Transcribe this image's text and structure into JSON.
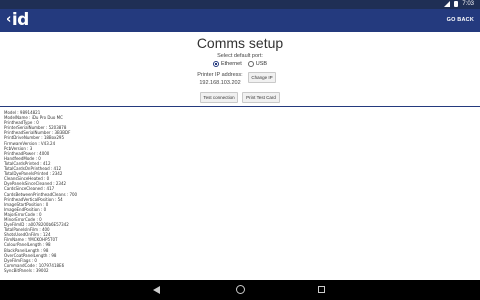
{
  "status_bar": {
    "time": "7:03"
  },
  "app_bar": {
    "logo": "id",
    "go_back": "GO BACK"
  },
  "header": {
    "title": "Comms setup",
    "subtitle": "Select default port:",
    "radio_ethernet": "Ethernet",
    "radio_usb": "USB",
    "ip_label": "Printer IP address:",
    "ip_value": "192.168.103.202",
    "change_ip": "Change IP",
    "test_connection": "Test connection",
    "print_test_card": "Print Test Card"
  },
  "printer_info": [
    "Model : 98914821",
    "ModelName : iDu Pro Duo MC",
    "PrintheadType : 0",
    "PrinterSerialNumber : 5203878",
    "PrintheadSerialNumber : 3B3BDF",
    "PrintDriveNumber : 18Box295",
    "FirmwareVersion : V43.24",
    "PcbVersion : 3",
    "PrintheadPower : 4000",
    "HandfeedMode : 0",
    "TotalCardsPrinted : 412",
    "TotalCardsOnPrinthead : 412",
    "TotalDyePanelsPrinted : 2342",
    "CleansSinceHeated : 0",
    "DyePanelsSinceCleaned : 2342",
    "CardsSinceCleaned : 417",
    "CardsBetweenPrintheadCleans : 700",
    "PrintheadVerticalPosition : 54",
    "ImageStartPosition : 0",
    "ImageEndPosition : 0",
    "MajorErrorCode : 0",
    "MinorErrorCode : 0",
    "DyeFilmID : a0078200b6E57342",
    "TotalPanelsInFilm : 400",
    "ShotsUsedOnFilm : 124",
    "FilmName : YMCKOHP5T0T",
    "ColourPanelLength : 98",
    "BlackPanelLength : 98",
    "OverCoatPanelLength : 98",
    "DyeFilmFlags : 0",
    "CommandCode : 10797418E6",
    "SyncBitPanels : 39002"
  ]
}
